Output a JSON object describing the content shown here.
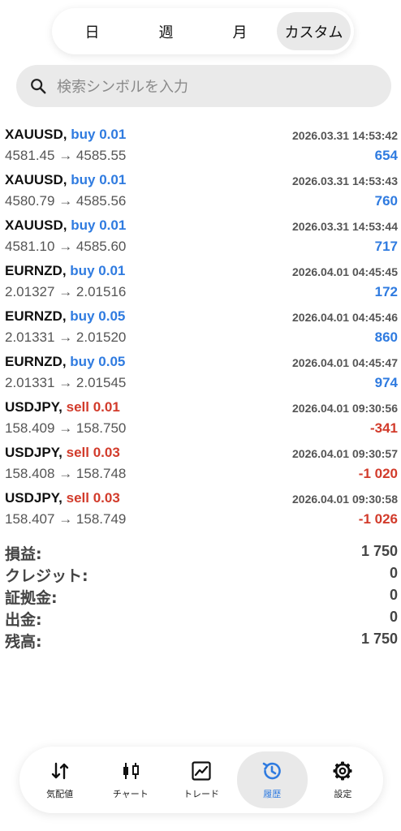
{
  "period_tabs": [
    {
      "label": "日",
      "active": false
    },
    {
      "label": "週",
      "active": false
    },
    {
      "label": "月",
      "active": false
    },
    {
      "label": "カスタム",
      "active": true
    }
  ],
  "search": {
    "placeholder": "検索シンボルを入力"
  },
  "deals": [
    {
      "symbol": "XAUUSD,",
      "side": "buy",
      "volume": "0.01",
      "time": "2026.03.31 14:53:42",
      "open": "4581.45",
      "close": "4585.55",
      "profit": "654"
    },
    {
      "symbol": "XAUUSD,",
      "side": "buy",
      "volume": "0.01",
      "time": "2026.03.31 14:53:43",
      "open": "4580.79",
      "close": "4585.56",
      "profit": "760"
    },
    {
      "symbol": "XAUUSD,",
      "side": "buy",
      "volume": "0.01",
      "time": "2026.03.31 14:53:44",
      "open": "4581.10",
      "close": "4585.60",
      "profit": "717"
    },
    {
      "symbol": "EURNZD,",
      "side": "buy",
      "volume": "0.01",
      "time": "2026.04.01 04:45:45",
      "open": "2.01327",
      "close": "2.01516",
      "profit": "172"
    },
    {
      "symbol": "EURNZD,",
      "side": "buy",
      "volume": "0.05",
      "time": "2026.04.01 04:45:46",
      "open": "2.01331",
      "close": "2.01520",
      "profit": "860"
    },
    {
      "symbol": "EURNZD,",
      "side": "buy",
      "volume": "0.05",
      "time": "2026.04.01 04:45:47",
      "open": "2.01331",
      "close": "2.01545",
      "profit": "974"
    },
    {
      "symbol": "USDJPY,",
      "side": "sell",
      "volume": "0.01",
      "time": "2026.04.01 09:30:56",
      "open": "158.409",
      "close": "158.750",
      "profit": "-341"
    },
    {
      "symbol": "USDJPY,",
      "side": "sell",
      "volume": "0.03",
      "time": "2026.04.01 09:30:57",
      "open": "158.408",
      "close": "158.748",
      "profit": "-1 020"
    },
    {
      "symbol": "USDJPY,",
      "side": "sell",
      "volume": "0.03",
      "time": "2026.04.01 09:30:58",
      "open": "158.407",
      "close": "158.749",
      "profit": "-1 026"
    }
  ],
  "price_arrow": "→",
  "summary": [
    {
      "label": "損益:",
      "value": "1 750"
    },
    {
      "label": "クレジット:",
      "value": "0"
    },
    {
      "label": "証拠金:",
      "value": "0"
    },
    {
      "label": "出金:",
      "value": "0"
    },
    {
      "label": "残高:",
      "value": "1 750"
    }
  ],
  "nav": [
    {
      "label": "気配値",
      "icon": "quotes-icon",
      "active": false
    },
    {
      "label": "チャート",
      "icon": "candlestick-icon",
      "active": false
    },
    {
      "label": "トレード",
      "icon": "trade-chart-icon",
      "active": false
    },
    {
      "label": "履歴",
      "icon": "history-icon",
      "active": true
    },
    {
      "label": "設定",
      "icon": "gear-icon",
      "active": false
    }
  ],
  "colors": {
    "buy": "#2f7be0",
    "sell": "#d23b2b",
    "active_nav": "#2f7be0"
  }
}
